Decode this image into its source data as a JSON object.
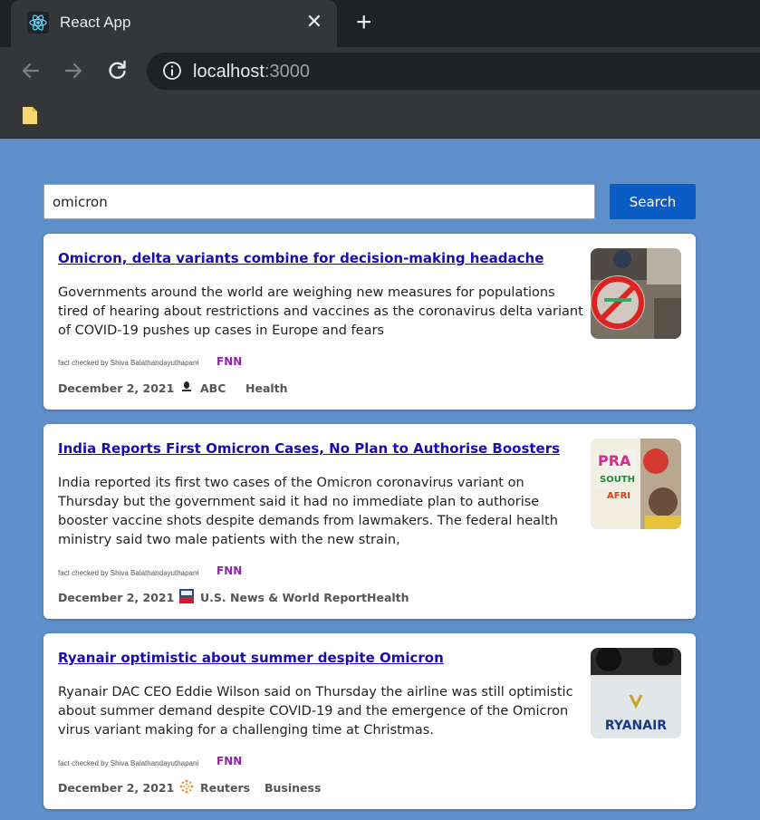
{
  "browser": {
    "tab_title": "React App",
    "tab_close": "✕",
    "new_tab": "+",
    "url_host": "localhost",
    "url_port": ":3000"
  },
  "search": {
    "value": "omicron",
    "button_label": "Search"
  },
  "articles": [
    {
      "title": "Omicron, delta variants combine for decision-making headache",
      "description": "Governments around the world are weighing new measures for populations tired of hearing about restrictions and vaccines as the coronavirus delta variant of COVID-19 pushes up cases in Europe and fears",
      "fact_checked": "fact checked by Shiva Balathandayuthapani",
      "fnn": "FNN",
      "date": "December 2, 2021",
      "source": "ABC",
      "category": "Health"
    },
    {
      "title": "India Reports First Omicron Cases, No Plan to Authorise Boosters",
      "description": "India reported its first two cases of the Omicron coronavirus variant on Thursday but the government said it had no immediate plan to authorise booster vaccine shots despite demands from lawmakers. The federal health ministry said two male patients with the new strain,",
      "fact_checked": "fact checked by Shiva Balathandayuthapani",
      "fnn": "FNN",
      "date": "December 2, 2021",
      "source": "U.S. News & World Report",
      "category": "Health"
    },
    {
      "title": "Ryanair optimistic about summer despite Omicron",
      "description": "Ryanair DAC CEO Eddie Wilson said on Thursday the airline was still optimistic about summer demand despite COVID-19 and the emergence of the Omicron virus variant making for a challenging time at Christmas.",
      "fact_checked": "fact checked by Shiva Balathandayuthapani",
      "fnn": "FNN",
      "date": "December 2, 2021",
      "source": "Reuters",
      "category": "Business",
      "thumb_text": "RYANAIR"
    }
  ],
  "colors": {
    "page_bg": "#5f8fca",
    "button": "#0b5cc5",
    "link": "#1a0dab",
    "fnn": "#8e24aa"
  }
}
